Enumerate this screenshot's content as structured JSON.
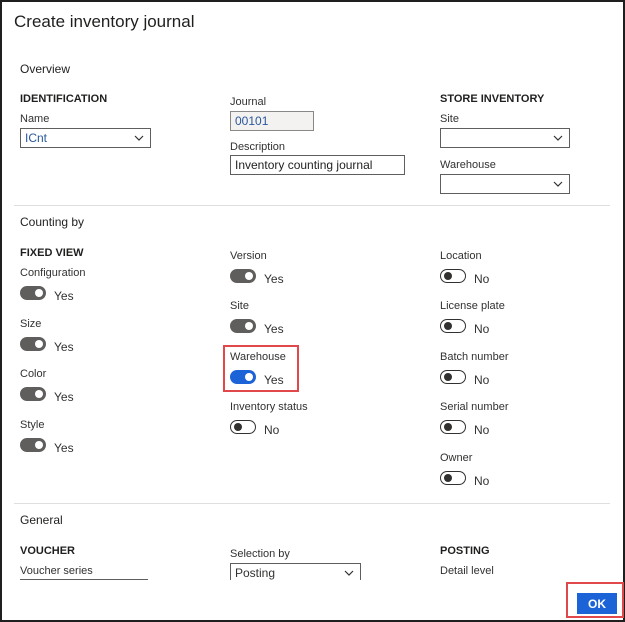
{
  "dialog": {
    "title": "Create inventory journal"
  },
  "overview": {
    "section_label": "Overview",
    "identification": {
      "group_label": "IDENTIFICATION",
      "name_label": "Name",
      "name_value": "ICnt"
    },
    "journal": {
      "journal_label": "Journal",
      "journal_value": "00101",
      "description_label": "Description",
      "description_value": "Inventory counting journal"
    },
    "store_inventory": {
      "group_label": "STORE INVENTORY",
      "site_label": "Site",
      "site_value": "",
      "warehouse_label": "Warehouse",
      "warehouse_value": ""
    }
  },
  "counting_by": {
    "section_label": "Counting by",
    "fixed_view_label": "FIXED VIEW",
    "col1": [
      {
        "label": "Configuration",
        "state": "Yes",
        "on": true
      },
      {
        "label": "Size",
        "state": "Yes",
        "on": true
      },
      {
        "label": "Color",
        "state": "Yes",
        "on": true
      },
      {
        "label": "Style",
        "state": "Yes",
        "on": true
      }
    ],
    "col2": [
      {
        "label": "Version",
        "state": "Yes",
        "on": true
      },
      {
        "label": "Site",
        "state": "Yes",
        "on": true
      },
      {
        "label": "Warehouse",
        "state": "Yes",
        "on": true
      },
      {
        "label": "Inventory status",
        "state": "No",
        "on": false
      }
    ],
    "col3": [
      {
        "label": "Location",
        "state": "No",
        "on": false
      },
      {
        "label": "License plate",
        "state": "No",
        "on": false
      },
      {
        "label": "Batch number",
        "state": "No",
        "on": false
      },
      {
        "label": "Serial number",
        "state": "No",
        "on": false
      },
      {
        "label": "Owner",
        "state": "No",
        "on": false
      }
    ]
  },
  "general": {
    "section_label": "General",
    "voucher_label": "VOUCHER",
    "voucher_series_label": "Voucher series",
    "selection_by_label": "Selection by",
    "selection_by_value": "Posting",
    "posting_label": "POSTING",
    "detail_level_label": "Detail level"
  },
  "footer": {
    "ok_label": "OK"
  },
  "colors": {
    "accent": "#1d63d8",
    "highlight": "#e0484b",
    "toggle_on": "#605e5c"
  }
}
